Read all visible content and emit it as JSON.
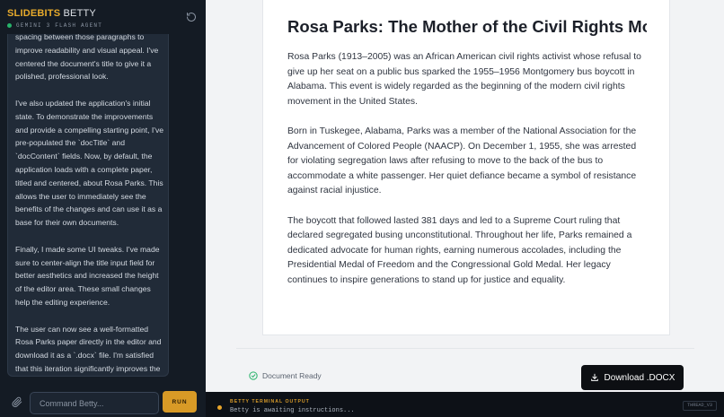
{
  "sidebar": {
    "brand_main": "SLIDEBITS",
    "brand_sub": "BETTY",
    "agent_label": "GEMINI 3 FLASH AGENT",
    "chat_paragraphs": [
      "spacing between those paragraphs to improve readability and visual appeal. I've centered the document's title to give it a polished, professional look.",
      "I've also updated the application's initial state. To demonstrate the improvements and provide a compelling starting point, I've pre-populated the `docTitle` and `docContent` fields. Now, by default, the application loads with a complete paper, titled and centered, about Rosa Parks. This allows the user to immediately see the benefits of the changes and can use it as a base for their own documents.",
      "Finally, I made some UI tweaks. I've made sure to center-align the title input field for better aesthetics and increased the height of the editor area. These small changes help the editing experience.",
      "The user can now see a well-formatted Rosa Parks paper directly in the editor and download it as a `.docx` file. I'm satisfied that this iteration significantly improves the overall workflow and output quality."
    ],
    "command_placeholder": "Command Betty...",
    "run_label": "RUN"
  },
  "document": {
    "title": "Rosa Parks: The Mother of the Civil Rights Movement",
    "paragraphs": [
      "Rosa Parks (1913–2005) was an African American civil rights activist whose refusal to give up her seat on a public bus sparked the 1955–1956 Montgomery bus boycott in Alabama. This event is widely regarded as the beginning of the modern civil rights movement in the United States.",
      "Born in Tuskegee, Alabama, Parks was a member of the National Association for the Advancement of Colored People (NAACP). On December 1, 1955, she was arrested for violating segregation laws after refusing to move to the back of the bus to accommodate a white passenger. Her quiet defiance became a symbol of resistance against racial injustice.",
      "The boycott that followed lasted 381 days and led to a Supreme Court ruling that declared segregated busing unconstitutional. Throughout her life, Parks remained a dedicated advocate for human rights, earning numerous accolades, including the Presidential Medal of Freedom and the Congressional Gold Medal. Her legacy continues to inspire generations to stand up for justice and equality."
    ]
  },
  "footer": {
    "status_text": "Document Ready",
    "download_label": "Download .DOCX"
  },
  "terminal": {
    "title": "BETTY TERMINAL OUTPUT",
    "output": "Betty is awaiting instructions...",
    "thread_label": "THREAD_V3"
  },
  "icons": {
    "reset": "refresh-icon",
    "attach": "paperclip-icon",
    "status": "check-circle-icon",
    "download": "download-icon"
  },
  "colors": {
    "accent": "#e8ab2c",
    "status_online": "#27b36a",
    "sidebar_bg": "#141b24",
    "button_dark": "#0d0f13"
  }
}
